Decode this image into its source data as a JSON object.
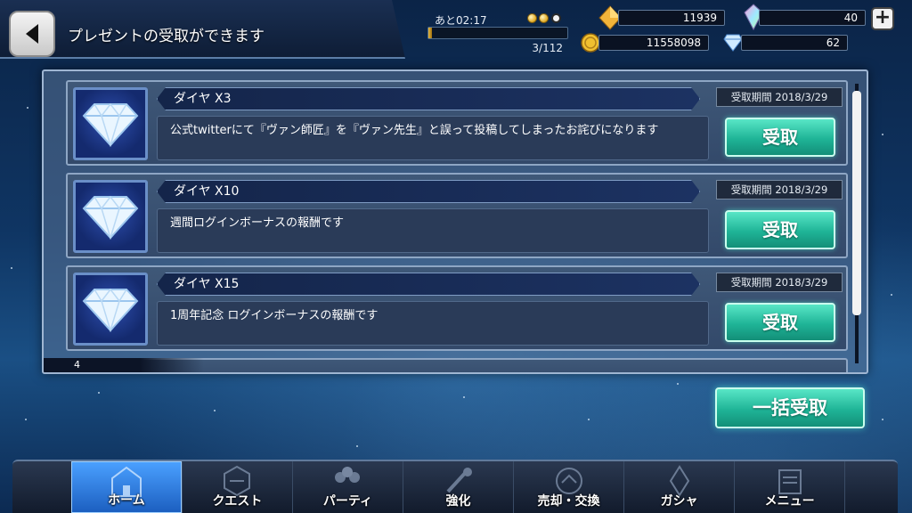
{
  "header": {
    "title": "プレゼントの受取ができます",
    "back_icon": "back-arrow-icon"
  },
  "stamina": {
    "timer": "あと02:17",
    "count": "3/112",
    "fill_fraction": 0.027,
    "orbs": [
      "gold",
      "gold",
      "empty"
    ]
  },
  "currencies": {
    "crystal": "11939",
    "gem": "40",
    "coin": "11558098",
    "diamond": "62"
  },
  "presents": [
    {
      "name": "ダイヤ X3",
      "description": "公式twitterにて『ヴァン師匠』を『ヴァン先生』と誤って投稿してしまったお詫びになります",
      "period": "受取期間 2018/3/29",
      "button": "受取",
      "icon": "diamond-icon"
    },
    {
      "name": "ダイヤ X10",
      "description": "週間ログインボーナスの報酬です",
      "period": "受取期間 2018/3/29",
      "button": "受取",
      "icon": "diamond-icon"
    },
    {
      "name": "ダイヤ X15",
      "description": "1周年記念 ログインボーナスの報酬です",
      "period": "受取期間 2018/3/29",
      "button": "受取",
      "icon": "diamond-icon"
    }
  ],
  "list": {
    "page_indicator": "4"
  },
  "bulk_button": "一括受取",
  "nav": [
    {
      "label": "ホーム",
      "icon": "home-icon",
      "active": true
    },
    {
      "label": "クエスト",
      "icon": "quest-icon",
      "active": false
    },
    {
      "label": "パーティ",
      "icon": "party-icon",
      "active": false
    },
    {
      "label": "強化",
      "icon": "enhance-icon",
      "active": false
    },
    {
      "label": "売却・交換",
      "icon": "sell-exchange-icon",
      "active": false
    },
    {
      "label": "ガシャ",
      "icon": "gacha-icon",
      "active": false
    },
    {
      "label": "メニュー",
      "icon": "menu-icon",
      "active": false
    }
  ],
  "colors": {
    "accent_button": "#1fb497",
    "nav_active": "#2f7fe0",
    "panel_bg": "#3f5878"
  }
}
